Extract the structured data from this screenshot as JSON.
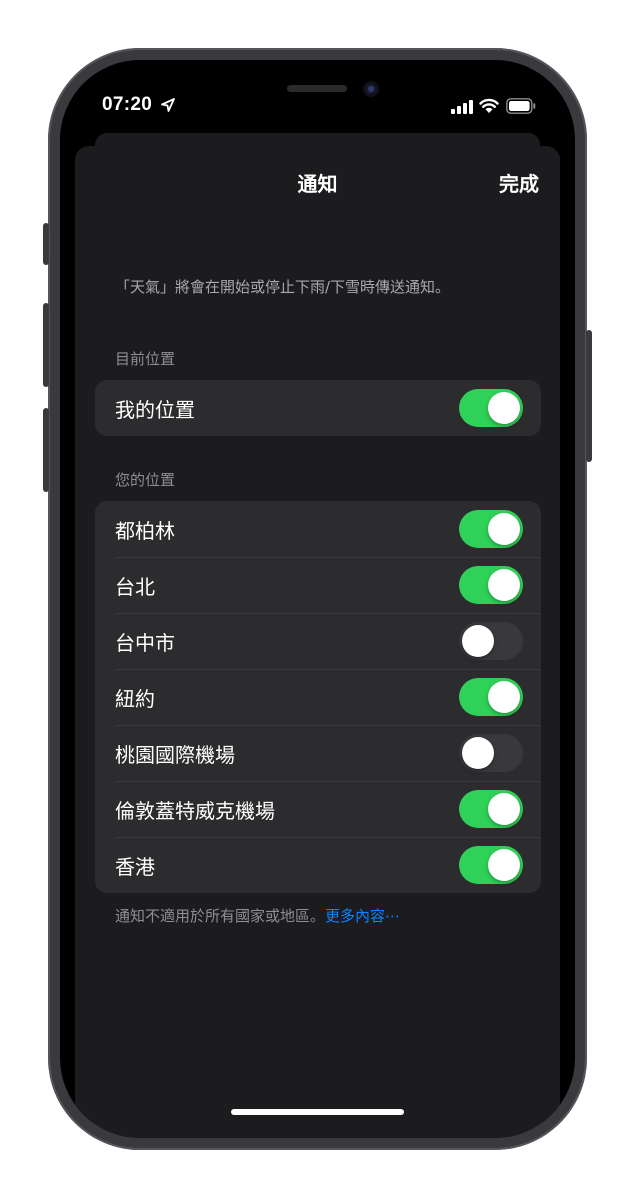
{
  "status_bar": {
    "time": "07:20",
    "location_icon": "location-arrow-icon",
    "signal_icon": "cellular-signal-icon",
    "wifi_icon": "wifi-icon",
    "battery_icon": "battery-icon"
  },
  "nav": {
    "title": "通知",
    "done_label": "完成"
  },
  "description": "「天氣」將會在開始或停止下雨/下雪時傳送通知。",
  "current_location": {
    "header": "目前位置",
    "items": [
      {
        "label": "我的位置",
        "on": true
      }
    ]
  },
  "your_locations": {
    "header": "您的位置",
    "items": [
      {
        "label": "都柏林",
        "on": true
      },
      {
        "label": "台北",
        "on": true
      },
      {
        "label": "台中市",
        "on": false
      },
      {
        "label": "紐約",
        "on": true
      },
      {
        "label": "桃園國際機場",
        "on": false
      },
      {
        "label": "倫敦蓋特威克機場",
        "on": true
      },
      {
        "label": "香港",
        "on": true
      }
    ]
  },
  "footer": {
    "note": "通知不適用於所有國家或地區。",
    "link": "更多內容⋯"
  },
  "colors": {
    "toggle_on": "#30d158",
    "toggle_off": "#39393d",
    "link": "#0a84ff",
    "sheet_bg": "#1c1c1e",
    "group_bg": "#2c2c2e"
  }
}
